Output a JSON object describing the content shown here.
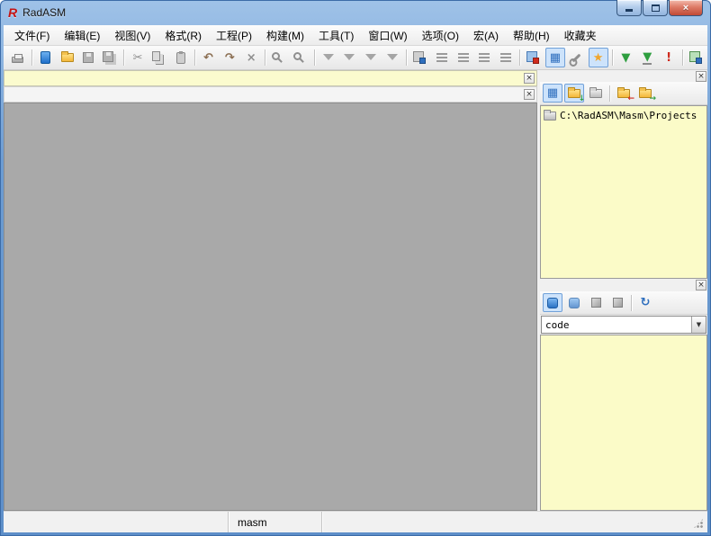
{
  "window": {
    "title": "RadASM",
    "logo_glyph": "R",
    "controls": {
      "close": "×"
    }
  },
  "menu": {
    "items": [
      "文件(F)",
      "编辑(E)",
      "视图(V)",
      "格式(R)",
      "工程(P)",
      "构建(M)",
      "工具(T)",
      "窗口(W)",
      "选项(O)",
      "宏(A)",
      "帮助(H)",
      "收藏夹"
    ]
  },
  "icons": {
    "cut": "✂",
    "undo": "↶",
    "redo": "↷",
    "delete": "×",
    "grid": "▦",
    "star": "★",
    "arrow_down": "▼",
    "exclamation": "!",
    "refresh": "↻",
    "combo_arrow": "▼",
    "close": "×",
    "arrow_left": "←",
    "arrow_right": "→",
    "arrow_down_small": "↓"
  },
  "toolbar": {
    "buttons": [
      "print",
      "new-file",
      "open-file",
      "save",
      "save-all",
      "cut",
      "copy",
      "paste",
      "undo",
      "redo",
      "delete",
      "find",
      "replace",
      "filter-1",
      "filter-2",
      "filter-3",
      "filter-4",
      "copy-special",
      "indent-1",
      "indent-2",
      "indent-3",
      "indent-4",
      "templates",
      "project-browser",
      "tools",
      "favorites",
      "get-update-1",
      "get-update-2",
      "alert",
      "add-ins"
    ]
  },
  "project_panel": {
    "path": "C:\\RadASM\\Masm\\Projects",
    "toolbar_buttons": [
      "files-view",
      "sync-folder",
      "new-folder",
      "folder-back",
      "folder-forward"
    ]
  },
  "code_panel": {
    "combo_value": "code",
    "toolbar_buttons": [
      "code-section",
      "data-section",
      "cube-1",
      "cube-2",
      "refresh"
    ]
  },
  "statusbar": {
    "panes": [
      "",
      "masm",
      ""
    ]
  }
}
